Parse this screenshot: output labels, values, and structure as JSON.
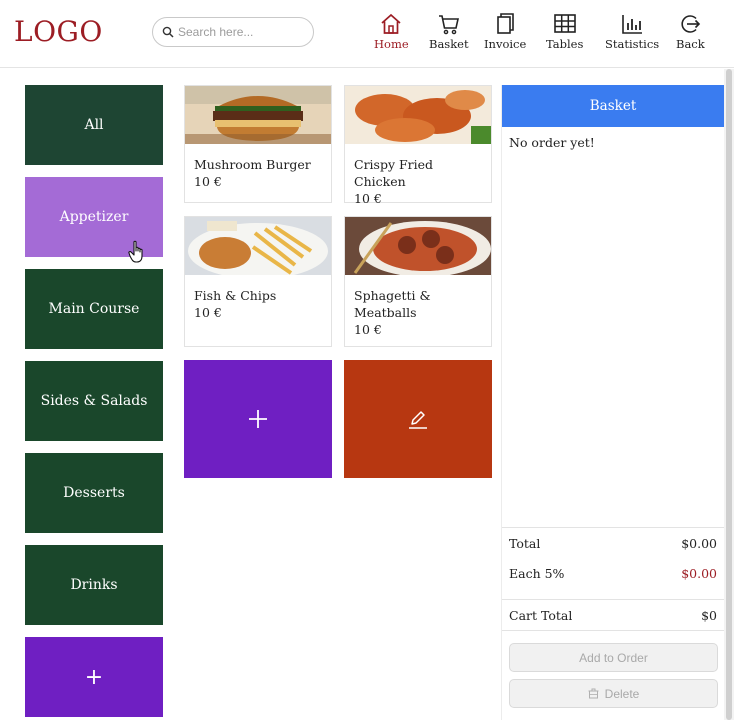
{
  "header": {
    "logo": "LOGO",
    "search_placeholder": "Search here...",
    "nav": [
      {
        "label": "Home",
        "icon": "home-icon",
        "active": true
      },
      {
        "label": "Basket",
        "icon": "cart-icon"
      },
      {
        "label": "Invoice",
        "icon": "invoice-icon"
      },
      {
        "label": "Tables",
        "icon": "tables-icon"
      },
      {
        "label": "Statistics",
        "icon": "statistics-icon"
      },
      {
        "label": "Back",
        "icon": "back-icon"
      }
    ]
  },
  "categories": [
    {
      "label": "All"
    },
    {
      "label": "Appetizer"
    },
    {
      "label": "Main Course"
    },
    {
      "label": "Sides & Salads"
    },
    {
      "label": "Desserts"
    },
    {
      "label": "Drinks"
    },
    {
      "label": "+"
    }
  ],
  "products": [
    {
      "name": "Mushroom Burger",
      "price": "10 €"
    },
    {
      "name": "Crispy Fried Chicken",
      "price": "10 €"
    },
    {
      "name": "Fish & Chips",
      "price": "10 €"
    },
    {
      "name": "Sphagetti & Meatballs",
      "price": "10 €"
    }
  ],
  "basket": {
    "title": "Basket",
    "empty_text": "No order yet!",
    "total_label": "Total",
    "total_value": "$0.00",
    "tax_label": "Each 5%",
    "tax_value": "$0.00",
    "cart_total_label": "Cart Total",
    "cart_total_value": "$0",
    "add_to_order": "Add to Order",
    "delete": "Delete"
  },
  "colors": {
    "logo": "#9c1d24",
    "category": "#1a472b",
    "category_hover": "#a46bd6",
    "add": "#6f1fc2",
    "edit": "#b73711",
    "basket_header": "#3a7cf0"
  }
}
